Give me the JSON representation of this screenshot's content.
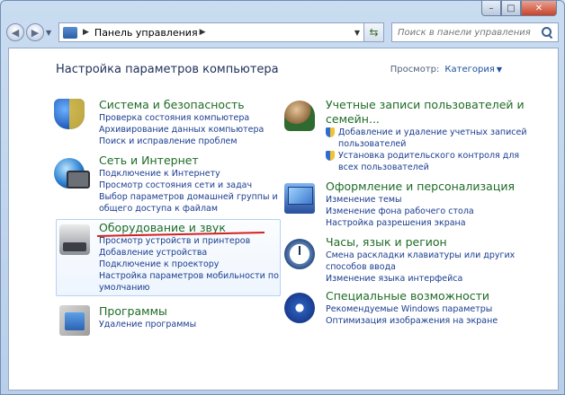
{
  "address": {
    "path": "Панель управления",
    "refresh": "⇆"
  },
  "search": {
    "placeholder": "Поиск в панели управления"
  },
  "header": {
    "title": "Настройка параметров компьютера",
    "view_label": "Просмотр:",
    "view_value": "Категория"
  },
  "categories": {
    "security": {
      "title": "Система и безопасность",
      "links": [
        "Проверка состояния компьютера",
        "Архивирование данных компьютера",
        "Поиск и исправление проблем"
      ]
    },
    "network": {
      "title": "Сеть и Интернет",
      "links": [
        "Подключение к Интернету",
        "Просмотр состояния сети и задач",
        "Выбор параметров домашней группы и",
        "общего доступа к файлам"
      ]
    },
    "hardware": {
      "title": "Оборудование и звук",
      "links": [
        "Просмотр устройств и принтеров",
        "Добавление устройства",
        "Подключение к проектору",
        "Настройка параметров мобильности по",
        "умолчанию"
      ]
    },
    "programs": {
      "title": "Программы",
      "links": [
        "Удаление программы"
      ]
    },
    "users": {
      "title_line1": "Учетные записи пользователей и",
      "title_line2": "семейн...",
      "links": [
        "Добавление и удаление учетных записей",
        "пользователей",
        "Установка родительского контроля для",
        "всех пользователей"
      ]
    },
    "appearance": {
      "title": "Оформление и персонализация",
      "links": [
        "Изменение темы",
        "Изменение фона рабочего стола",
        "Настройка разрешения экрана"
      ]
    },
    "clock": {
      "title": "Часы, язык и регион",
      "links": [
        "Смена раскладки клавиатуры или других",
        "способов ввода",
        "Изменение языка интерфейса"
      ]
    },
    "access": {
      "title": "Специальные возможности",
      "links": [
        "Рекомендуемые Windows параметры",
        "Оптимизация изображения на экране"
      ]
    }
  },
  "window": {
    "min": "–",
    "max": "□",
    "close": "✕"
  }
}
